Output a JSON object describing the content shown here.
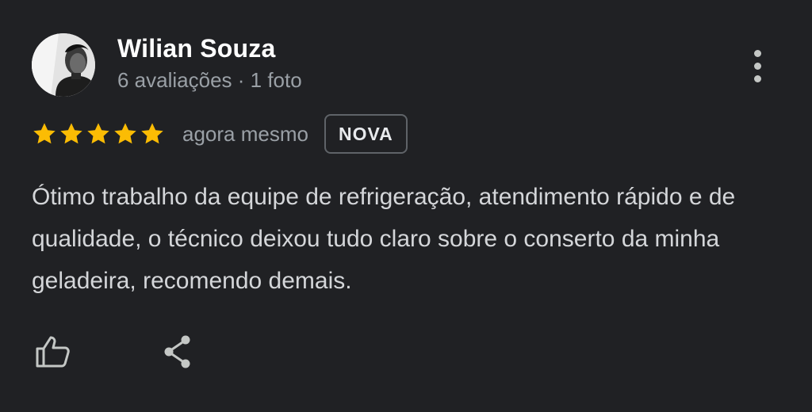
{
  "review": {
    "author": {
      "name": "Wilian Souza",
      "meta": "6 avaliações · 1 foto",
      "avatar_icon": "user-photo"
    },
    "rating": 5,
    "rating_max": 5,
    "time": "agora mesmo",
    "badge": "NOVA",
    "text": "Ótimo trabalho da equipe de refrigeração, atendimento rápido e de qualidade, o técnico deixou tudo claro sobre o conserto da minha geladeira, recomendo demais.",
    "actions": {
      "like_icon": "thumb-up-icon",
      "share_icon": "share-icon",
      "more_icon": "more-vert-icon"
    }
  },
  "colors": {
    "background": "#202124",
    "star": "#fbbc04",
    "secondary_text": "#9aa0a6",
    "primary_text": "#ffffff"
  }
}
